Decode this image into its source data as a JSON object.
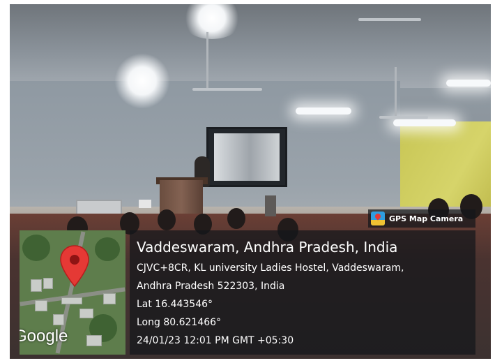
{
  "badge": {
    "app_name": "GPS Map Camera",
    "icon": "gps-map-camera-icon"
  },
  "location": {
    "title": "Vaddeswaram, Andhra Pradesh, India",
    "address_line1": "CJVC+8CR, KL university Ladies Hostel, Vaddeswaram,",
    "address_line2": "Andhra Pradesh 522303, India",
    "latitude": "Lat 16.443546°",
    "longitude": "Long 80.621466°",
    "timestamp": "24/01/23 12:01 PM GMT +05:30"
  },
  "map": {
    "provider_label": "Google",
    "marker_color": "#e53935"
  },
  "colors": {
    "overlay_bg": "#14161a",
    "wall_accent": "#d6d46a"
  }
}
